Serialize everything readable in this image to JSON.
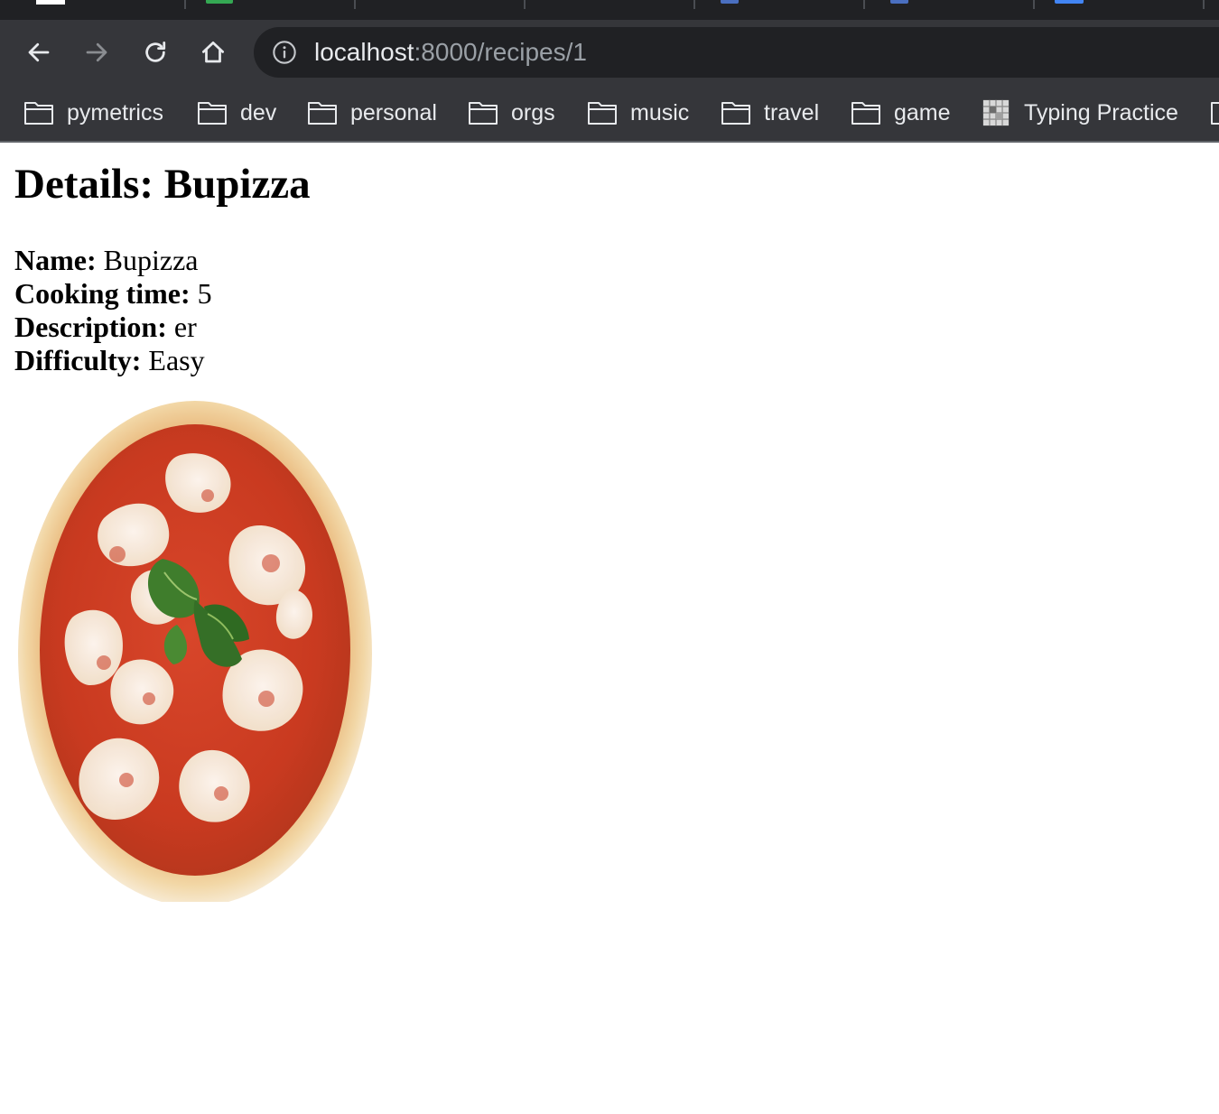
{
  "browser": {
    "url": {
      "host": "localhost",
      "path": ":8000/recipes/1"
    },
    "bookmarks": [
      {
        "label": "pymetrics",
        "icon": "folder-icon"
      },
      {
        "label": "dev",
        "icon": "folder-icon"
      },
      {
        "label": "personal",
        "icon": "folder-icon"
      },
      {
        "label": "orgs",
        "icon": "folder-icon"
      },
      {
        "label": "music",
        "icon": "folder-icon"
      },
      {
        "label": "travel",
        "icon": "folder-icon"
      },
      {
        "label": "game",
        "icon": "folder-icon"
      },
      {
        "label": "Typing Practice",
        "icon": "keyboard-favicon-icon"
      }
    ],
    "colors": {
      "chrome_dark": "#202124",
      "toolbar": "#35363a",
      "text": "#e8eaed",
      "muted": "#9aa0a6"
    }
  },
  "page": {
    "heading": "Details: Bupizza",
    "fields": [
      {
        "label": "Name:",
        "value": "Bupizza"
      },
      {
        "label": "Cooking time:",
        "value": "5"
      },
      {
        "label": "Description:",
        "value": "er"
      },
      {
        "label": "Difficulty:",
        "value": "Easy"
      }
    ],
    "image_subject": "pizza-margherita-image"
  }
}
